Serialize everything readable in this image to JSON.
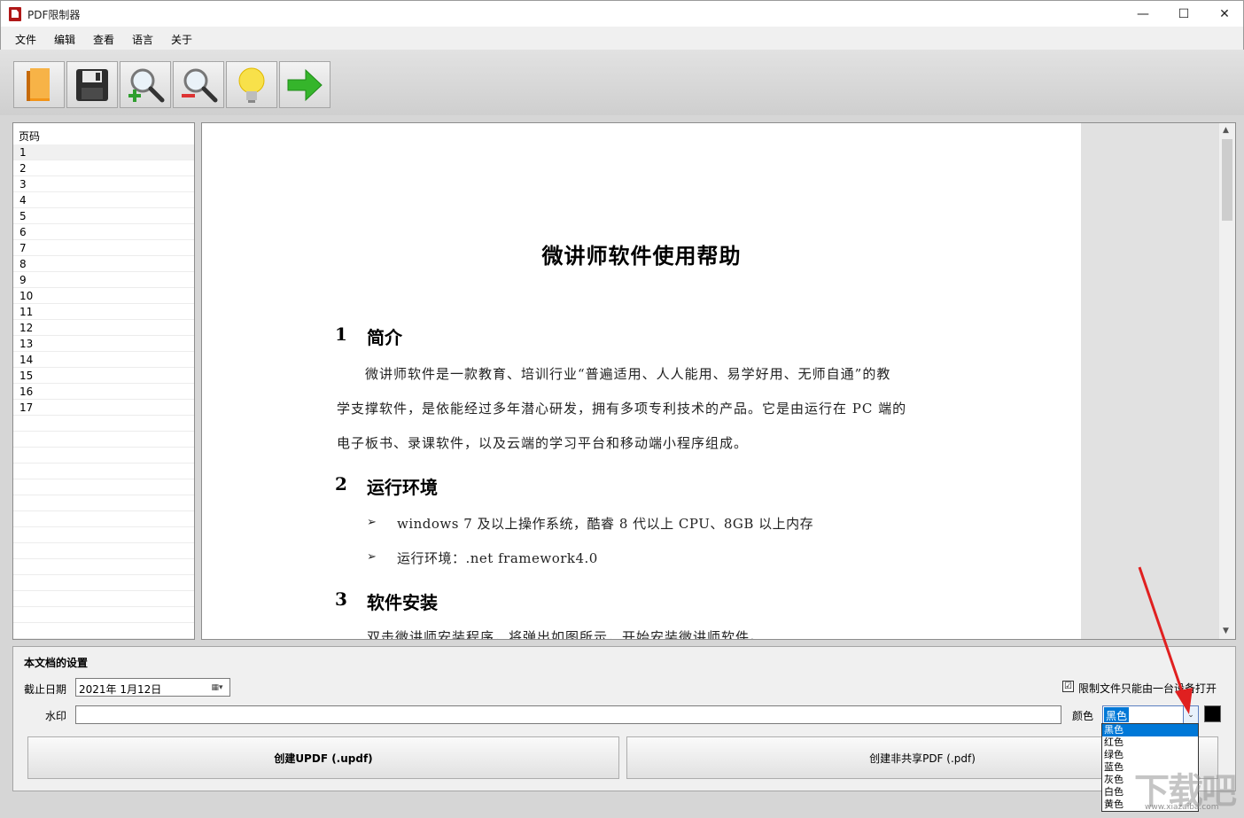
{
  "window": {
    "title": "PDF限制器",
    "min": "—",
    "max": "☐",
    "close": "✕"
  },
  "menu": [
    "文件",
    "编辑",
    "查看",
    "语言",
    "关于"
  ],
  "toolbar": {
    "buttons": [
      {
        "name": "open-icon",
        "color": "#f08a1c"
      },
      {
        "name": "save-icon",
        "color": "#2a2a2a"
      },
      {
        "name": "zoom-in-icon",
        "color": "#2f9e2f"
      },
      {
        "name": "zoom-out-icon",
        "color": "#d33"
      },
      {
        "name": "lightbulb-icon",
        "color": "#f5d21c"
      },
      {
        "name": "arrow-right-icon",
        "color": "#32b32a"
      }
    ]
  },
  "pagelist": {
    "header": "页码",
    "pages": [
      "1",
      "2",
      "3",
      "4",
      "5",
      "6",
      "7",
      "8",
      "9",
      "10",
      "11",
      "12",
      "13",
      "14",
      "15",
      "16",
      "17"
    ],
    "selected_index": 0
  },
  "document": {
    "title": "微讲师软件使用帮助",
    "sections": [
      {
        "num": "1",
        "title": "简介"
      },
      {
        "num": "2",
        "title": "运行环境"
      },
      {
        "num": "3",
        "title": "软件安装"
      }
    ],
    "intro_lines": [
      "　　微讲师软件是一款教育、培训行业“普遍适用、人人能用、易学好用、无师自通”的教",
      "学支撑软件，是依能经过多年潜心研发，拥有多项专利技术的产品。它是由运行在 PC 端的",
      "电子板书、录课软件，以及云端的学习平台和移动端小程序组成。"
    ],
    "env_bullets": [
      "windows 7 及以上操作系统，酷睿 8 代以上 CPU、8GB 以上内存",
      "运行环境：.net framework4.0"
    ],
    "bullet_char": "➢",
    "install_line": "双击微讲师安装程序，将弹出如图所示，开始安装微讲师软件。"
  },
  "settings": {
    "title": "本文档的设置",
    "expiry_label": "截止日期",
    "expiry_value": "2021年  1月12日",
    "watermark_label": "水印",
    "watermark_value": "",
    "restrict_label": "限制文件只能由一台设备打开",
    "restrict_checked": "☑",
    "color_label": "颜色",
    "color_value": "黑色",
    "color_options": [
      "黑色",
      "红色",
      "绿色",
      "蓝色",
      "灰色",
      "白色",
      "黄色"
    ],
    "swatch_color": "#000000",
    "btn_updf": "创建UPDF (.updf)",
    "btn_pdf": "创建非共享PDF (.pdf)"
  },
  "watermark_logo": {
    "text": "下载吧",
    "sub": "www.xiazaiba.com"
  }
}
